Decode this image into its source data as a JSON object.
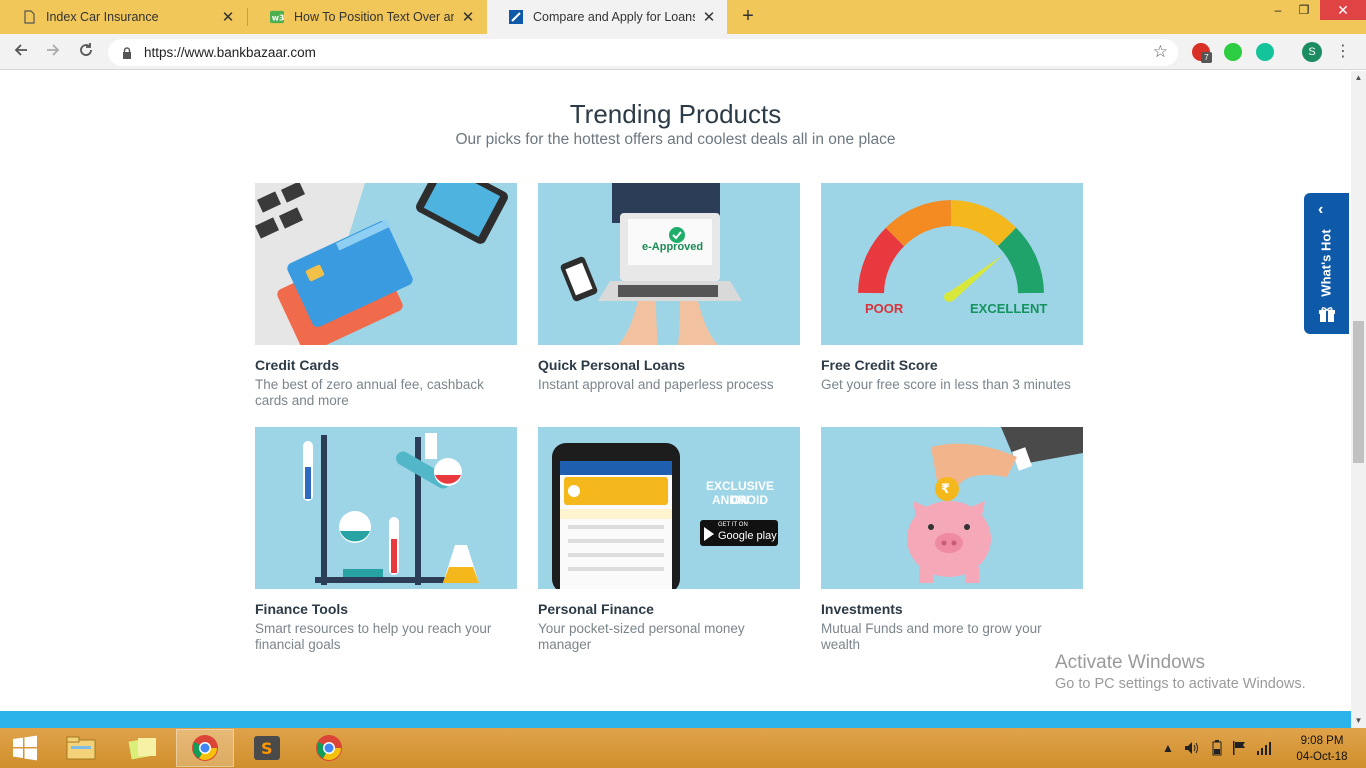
{
  "browser": {
    "tabs": [
      {
        "title": "Index Car Insurance",
        "close": "✕"
      },
      {
        "title": "How To Position Text Over an Im",
        "close": "✕"
      },
      {
        "title": "Compare and Apply for Loans, Cr",
        "close": "✕"
      }
    ],
    "new_tab": "+",
    "window_controls": {
      "minimize": "–",
      "maximize": "❐",
      "close": "✕"
    },
    "url": "https://www.bankbazaar.com",
    "extension_badge": "7",
    "profile_initial": "S"
  },
  "page": {
    "title": "Trending Products",
    "subtitle": "Our picks for the hottest offers and coolest deals all in one place",
    "cards": [
      {
        "name": "Credit Cards",
        "desc": "The best of zero annual fee, cashback cards and more",
        "illustration": "credit-cards-illustration"
      },
      {
        "name": "Quick Personal Loans",
        "desc": "Instant approval and paperless process",
        "illustration": "laptop-approval-illustration",
        "badge": "e-Approved"
      },
      {
        "name": "Free Credit Score",
        "desc": "Get your free score in less than 3 minutes",
        "illustration": "credit-score-gauge",
        "gauge_low": "POOR",
        "gauge_high": "EXCELLENT"
      },
      {
        "name": "Finance Tools",
        "desc": "Smart resources to help you reach your financial goals",
        "illustration": "lab-equipment-illustration"
      },
      {
        "name": "Personal Finance",
        "desc": "Your pocket-sized personal money manager",
        "illustration": "phone-app-illustration",
        "promo_line1": "EXCLUSIVE ON",
        "promo_line2": "ANDROID",
        "store_small": "GET IT ON",
        "store_big": "Google play"
      },
      {
        "name": "Investments",
        "desc": "Mutual Funds and more to grow your wealth",
        "illustration": "piggy-bank-illustration",
        "coin": "₹"
      }
    ],
    "whats_hot": "What's Hot"
  },
  "watermark": {
    "line1": "Activate Windows",
    "line2": "Go to PC settings to activate Windows."
  },
  "taskbar": {
    "time": "9:08 PM",
    "date": "04-Oct-18"
  },
  "colors": {
    "tab_strip": "#f1c75a",
    "card_bg": "#9dd5e6",
    "whats_hot": "#0e5aa8",
    "taskbar": "#d89a3a",
    "accent_bar": "#2ab4ea"
  }
}
